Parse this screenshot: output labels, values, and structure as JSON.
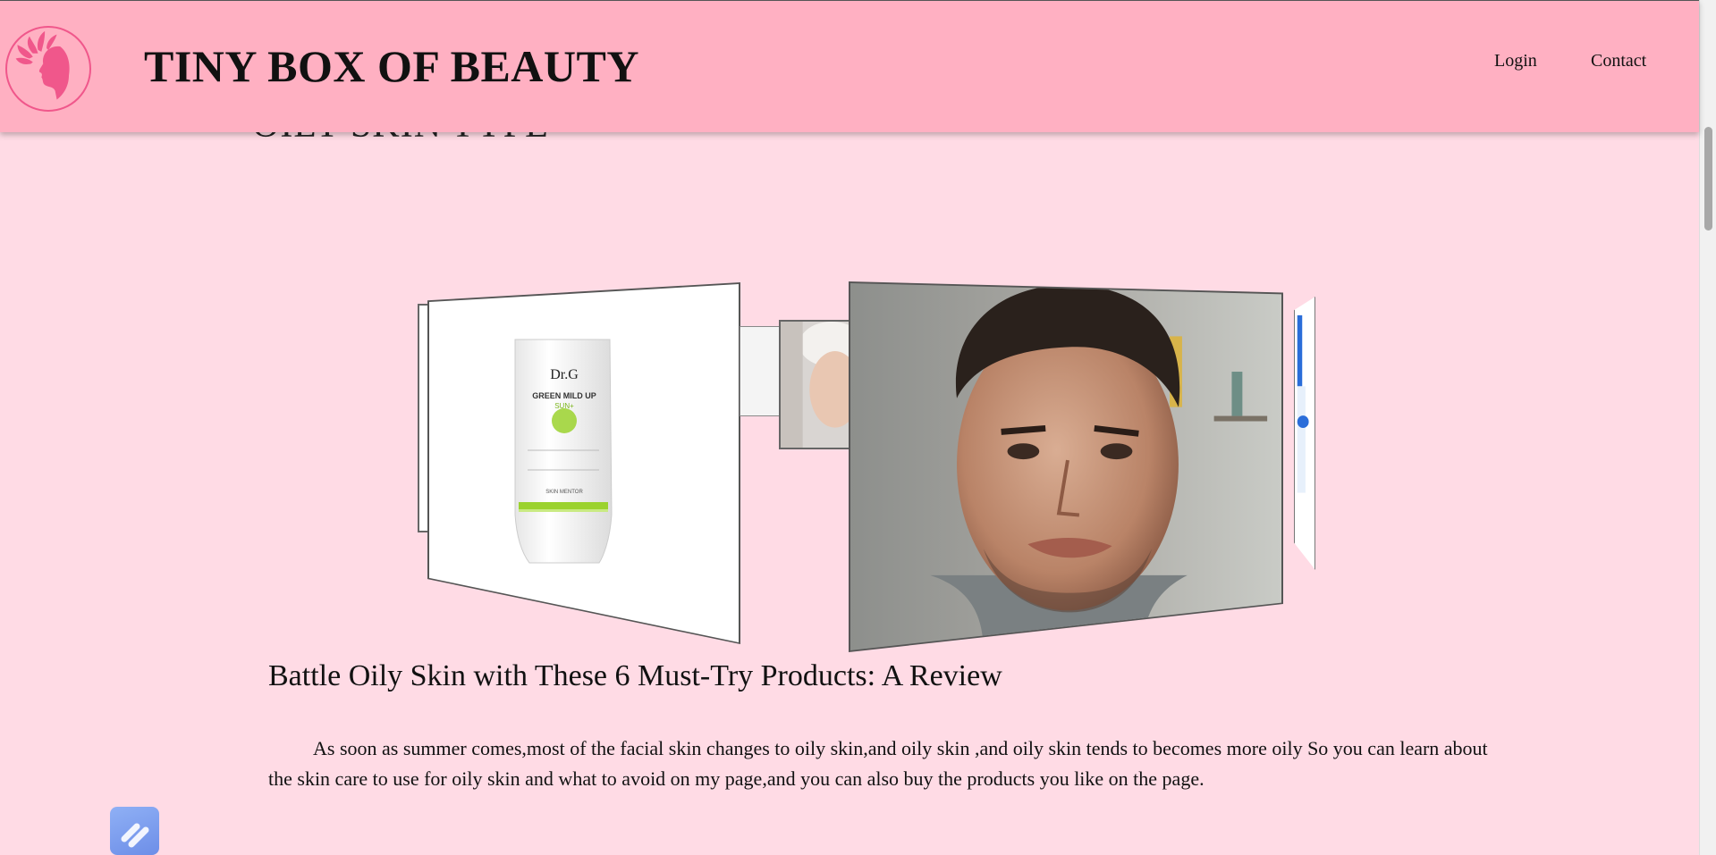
{
  "header": {
    "site_title": "TINY BOX OF BEAUTY",
    "nav": {
      "login": "Login",
      "contact": "Contact"
    }
  },
  "page_heading": "OILY SKIN TYPE",
  "carousel": {
    "product_brand": "Dr.G",
    "product_name_line1": "GREEN MILD UP",
    "product_name_line2": "SUN+",
    "product_footer": "SKIN MENTOR"
  },
  "article": {
    "title": "Battle Oily Skin with These 6 Must-Try Products: A Review",
    "body": "As soon as summer comes,most of the facial skin changes to oily skin,and oily skin ,and oily skin tends to becomes more oily So you can learn about the skin care to use for oily skin and what to avoid on my page,and you can also buy the products you like on the page."
  },
  "colors": {
    "background": "#ffdbe5",
    "header": "#ffb0c2",
    "logo_accent": "#f0578b",
    "float_button": "#7c9cf0"
  }
}
